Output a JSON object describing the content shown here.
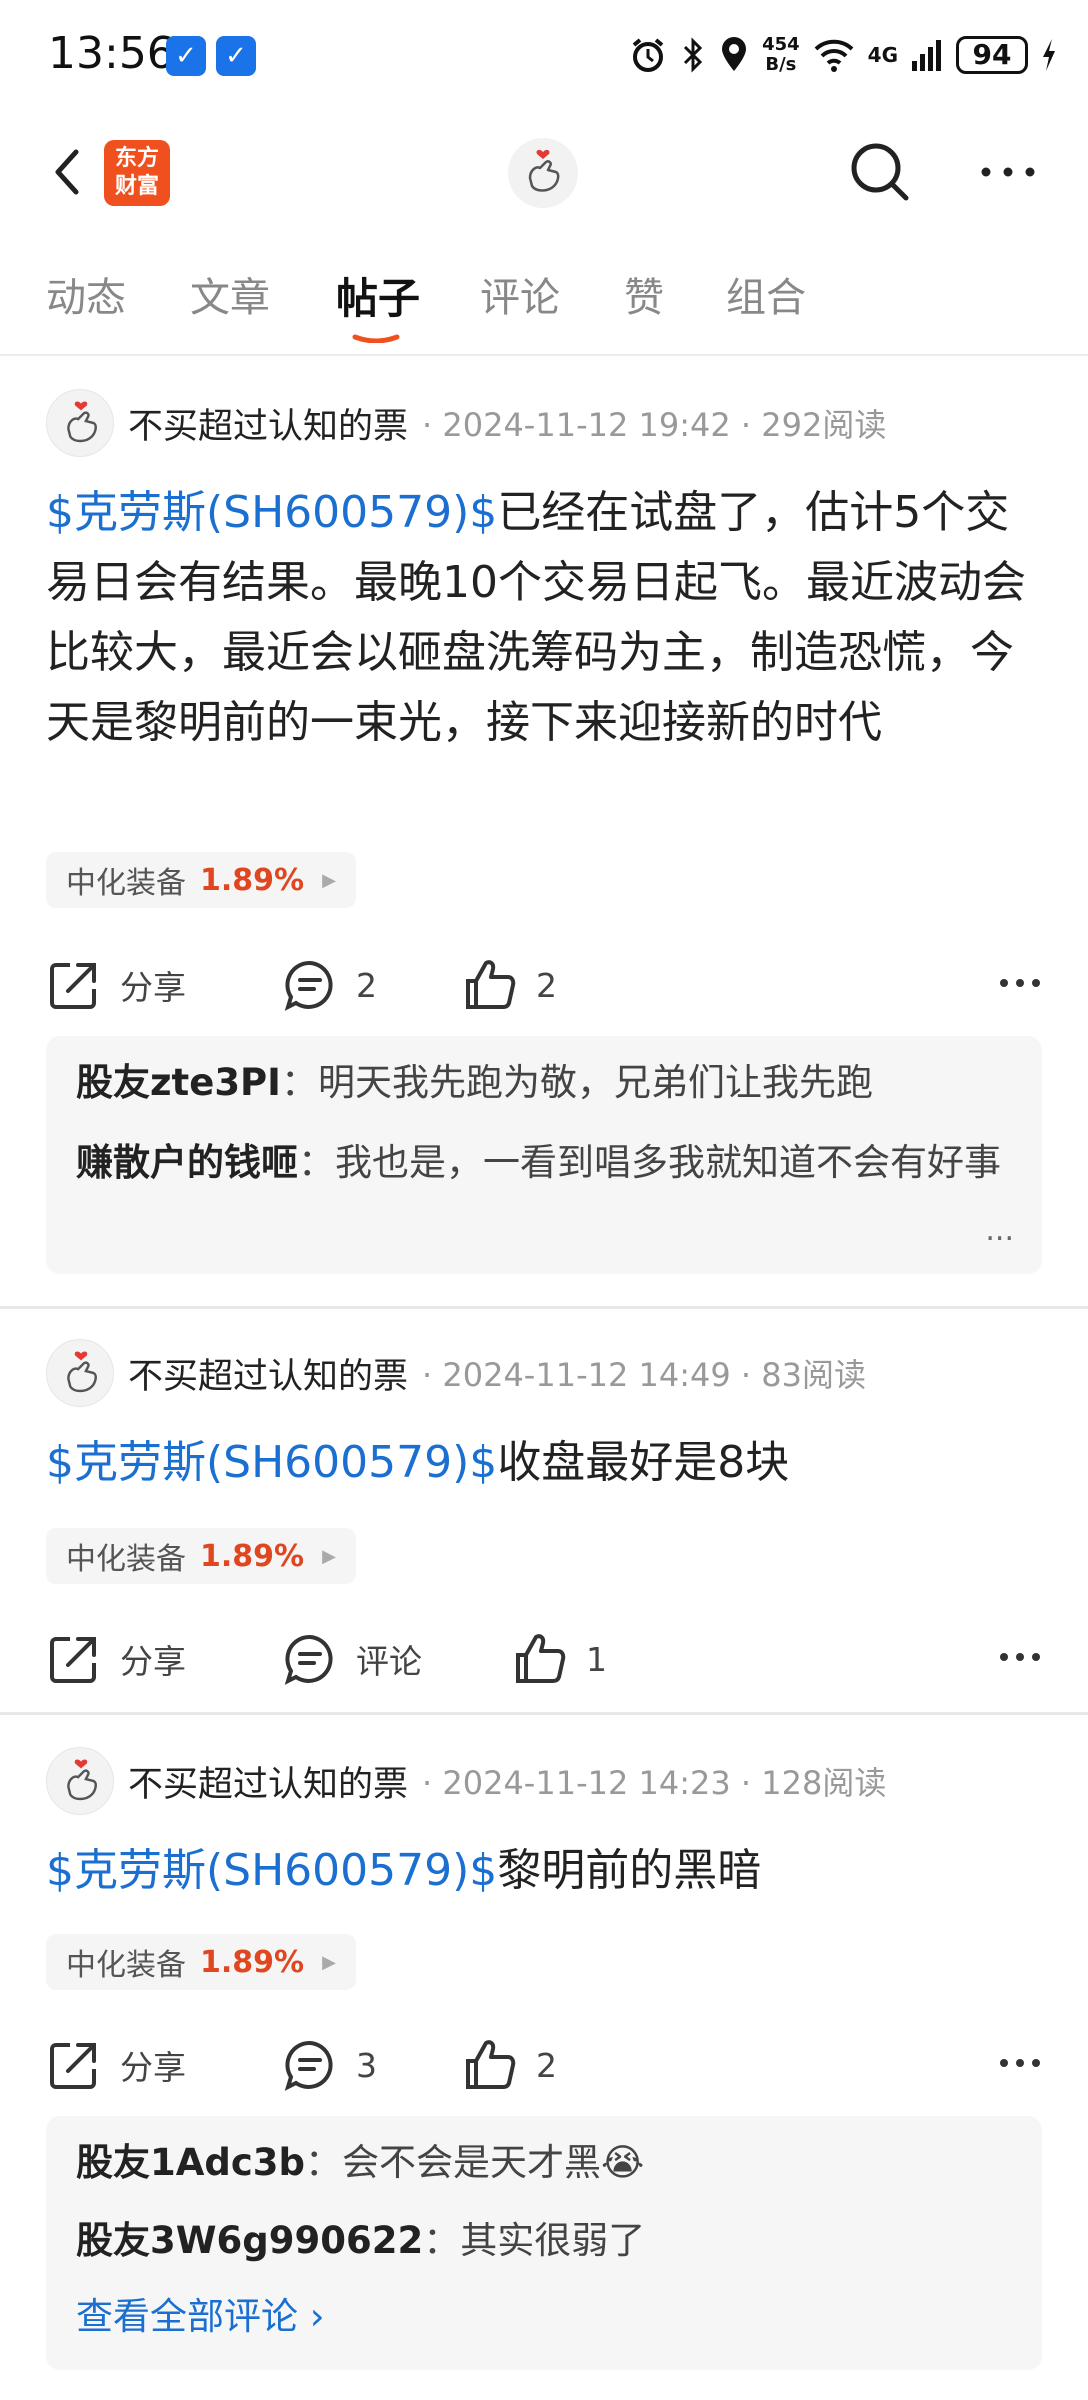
{
  "status_bar": {
    "time": "13:56",
    "speed_top": "454",
    "speed_bottom": "B/s",
    "network": "4G",
    "battery": "94"
  },
  "header": {
    "brand_line1": "东方",
    "brand_line2": "财富"
  },
  "tabs": [
    {
      "label": "动态"
    },
    {
      "label": "文章"
    },
    {
      "label": "帖子"
    },
    {
      "label": "评论"
    },
    {
      "label": "赞"
    },
    {
      "label": "组合"
    }
  ],
  "colors": {
    "accent": "#1a6fd0",
    "up": "#e0461f",
    "tab_underline": "#f0501e"
  },
  "posts": [
    {
      "author": "不买超过认知的票",
      "meta": "· 2024-11-12 19:42 · 292阅读",
      "stock": "$克劳斯(SH600579)$",
      "text": "已经在试盘了，估计5个交易日会有结果。最晚10个交易日起飞。最近波动会比较大，最近会以砸盘洗筹码为主，制造恐慌，今天是黎明前的一束光，接下来迎接新的时代",
      "chip_name": "中化装备",
      "chip_pct": "1.89%",
      "share": "分享",
      "comment": "2",
      "like": "2",
      "comments": [
        {
          "user": "股友zte3PI",
          "sep": "：",
          "text": "明天我先跑为敬，兄弟们让我先跑"
        },
        {
          "user": "赚散户的钱咂",
          "sep": "：",
          "text": "我也是，一看到唱多我就知道不会有好事"
        }
      ],
      "ellipsis": "..."
    },
    {
      "author": "不买超过认知的票",
      "meta": "· 2024-11-12 14:49 · 83阅读",
      "stock": "$克劳斯(SH600579)$",
      "text": "收盘最好是8块",
      "chip_name": "中化装备",
      "chip_pct": "1.89%",
      "share": "分享",
      "comment": "评论",
      "like": "1"
    },
    {
      "author": "不买超过认知的票",
      "meta": "· 2024-11-12 14:23 · 128阅读",
      "stock": "$克劳斯(SH600579)$",
      "text": "黎明前的黑暗",
      "chip_name": "中化装备",
      "chip_pct": "1.89%",
      "share": "分享",
      "comment": "3",
      "like": "2",
      "comments": [
        {
          "user": "股友1Adc3b",
          "sep": "：",
          "text": "会不会是天才黑😭"
        },
        {
          "user": "股友3W6g990622",
          "sep": "：",
          "text": "其实很弱了"
        }
      ],
      "view_all": "查看全部评论 ›"
    }
  ]
}
